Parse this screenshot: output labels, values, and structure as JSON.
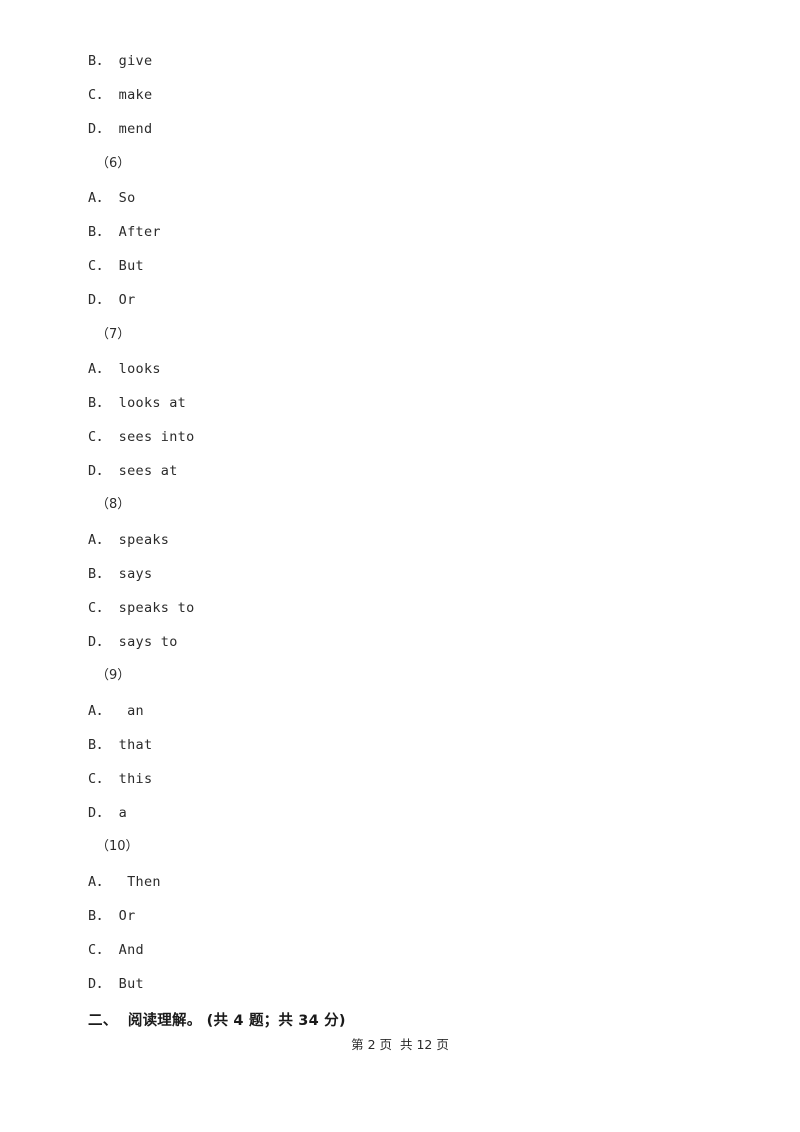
{
  "document": {
    "options_lines": [
      "B． give",
      "C． make",
      "D． mend"
    ],
    "groups": [
      {
        "number": "（6）",
        "options": [
          "A． So",
          "B． After",
          "C． But",
          "D． Or"
        ]
      },
      {
        "number": "（7）",
        "options": [
          "A． looks",
          "B． looks at",
          "C． sees into",
          "D． sees at"
        ]
      },
      {
        "number": "（8）",
        "options": [
          "A． speaks",
          "B． says",
          "C． speaks to",
          "D． says to"
        ]
      },
      {
        "number": "（9）",
        "options": [
          "A．  an",
          "B． that",
          "C． this",
          "D． a"
        ]
      },
      {
        "number": "（10）",
        "options": [
          "A．  Then",
          "B． Or",
          "C． And",
          "D． But"
        ]
      }
    ],
    "section_heading": "二、  阅读理解。 (共 4 题；共 34 分)",
    "footer": "第 2 页  共 12 页"
  }
}
